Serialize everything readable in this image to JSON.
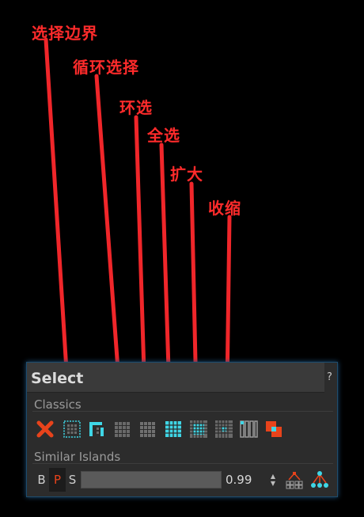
{
  "annotations": {
    "select_border": "选择边界",
    "loop_select": "循环选择",
    "ring_select": "环选",
    "select_all": "全选",
    "grow": "扩大",
    "shrink": "收缩"
  },
  "panel": {
    "title": "Select",
    "help": "?",
    "sections": {
      "classics": "Classics",
      "similar_islands": "Similar Islands"
    },
    "similar": {
      "mode_b": "B",
      "mode_p": "P",
      "mode_s": "S",
      "active_mode": "P",
      "threshold": "0.99"
    }
  },
  "colors": {
    "annotation": "#ff2b2b",
    "accent_orange": "#e8431b",
    "accent_cyan": "#3fd6e6",
    "panel_bg": "#2c2c2c"
  },
  "icons": {
    "deselect": "x-icon",
    "select_border": "grid-border-icon",
    "select_loop": "loop-icon",
    "select_ring": "ring-grid-icon",
    "select_all_dim": "grid-dim-icon",
    "select_all": "grid-cyan-icon",
    "grow": "grow-grid-icon",
    "shrink": "shrink-grid-icon",
    "columns": "columns-icon",
    "overlap": "overlap-squares-icon",
    "similar_a": "tree-dots-icon",
    "similar_b": "tree-cyan-icon"
  }
}
